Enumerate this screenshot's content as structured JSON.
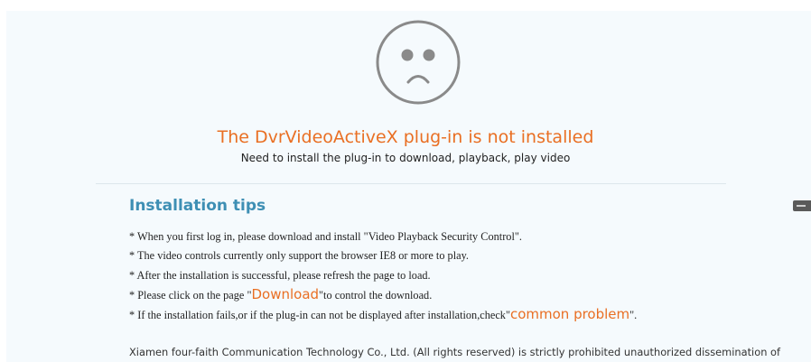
{
  "notice": {
    "icon": "sad-face-icon",
    "title": "The DvrVideoActiveX plug-in is not installed",
    "subtitle": "Need to install the plug-in to download, playback, play video"
  },
  "tips": {
    "heading": "Installation tips",
    "items": [
      "* When you first log in, please download and install \"Video Playback Security Control\".",
      "* The video controls currently only support the browser IE8 or more to play.",
      "* After the installation is successful, please refresh the page to load."
    ],
    "download_prefix": "* Please click on the page \"",
    "download_link": "Download",
    "download_suffix": "\"to control the download.",
    "problem_prefix": "* If the installation fails,or if the plug-in can not be displayed after installation,check\"",
    "problem_link": "common problem",
    "problem_suffix": "\"."
  },
  "footer": {
    "text": "Xiamen four-faith Communication Technology Co., Ltd. (All rights reserved) is strictly prohibited unauthorized dissemination of"
  },
  "colors": {
    "accent": "#e96f23",
    "heading": "#3e8fb4",
    "panel": "#f5fafd",
    "icon": "#8a8a8a"
  }
}
